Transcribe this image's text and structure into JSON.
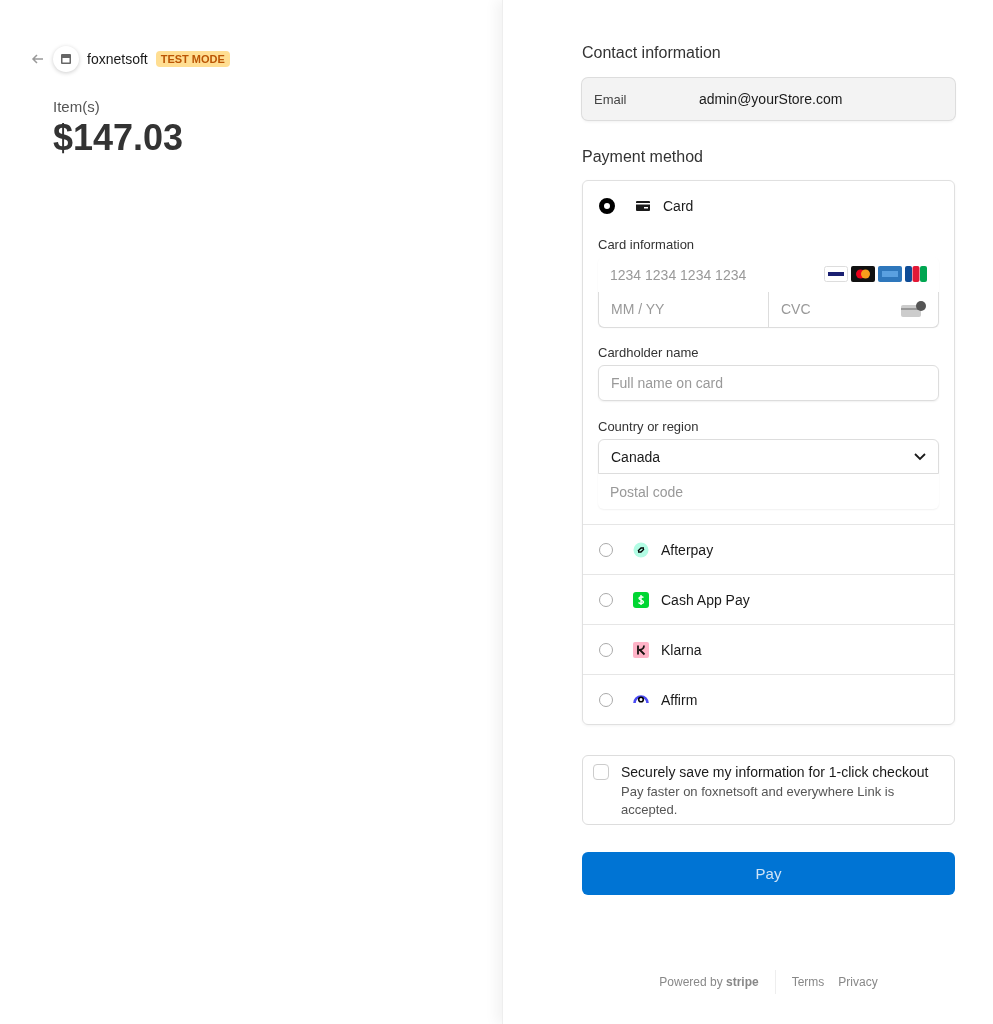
{
  "merchant": {
    "name": "foxnetsoft",
    "badge": "TEST MODE"
  },
  "summary": {
    "label": "Item(s)",
    "amount": "$147.03"
  },
  "contact": {
    "heading": "Contact information",
    "email_label": "Email",
    "email": "admin@yourStore.com"
  },
  "payment": {
    "heading": "Payment method",
    "methods": [
      {
        "kind": "card",
        "label": "Card",
        "selected": true,
        "color": "#1a1a1a"
      },
      {
        "kind": "afterpay",
        "label": "Afterpay",
        "selected": false,
        "color": "#b2fce4"
      },
      {
        "kind": "cashapp",
        "label": "Cash App Pay",
        "selected": false,
        "color": "#00d632"
      },
      {
        "kind": "klarna",
        "label": "Klarna",
        "selected": false,
        "color": "#ffb3c7"
      },
      {
        "kind": "affirm",
        "label": "Affirm",
        "selected": false,
        "color": "#4a4af4"
      }
    ]
  },
  "card_form": {
    "card_label": "Card information",
    "number_placeholder": "1234 1234 1234 1234",
    "expiry_placeholder": "MM / YY",
    "cvc_placeholder": "CVC",
    "name_label": "Cardholder name",
    "name_placeholder": "Full name on card",
    "country_label": "Country or region",
    "country": "Canada",
    "postal_placeholder": "Postal code"
  },
  "save_info": {
    "checked": false,
    "title": "Securely save my information for 1-click checkout",
    "description": "Pay faster on foxnetsoft and everywhere Link is accepted."
  },
  "pay_button": "Pay",
  "footer": {
    "powered": "Powered by **stripe**",
    "links": [
      "Terms",
      "Privacy"
    ]
  }
}
